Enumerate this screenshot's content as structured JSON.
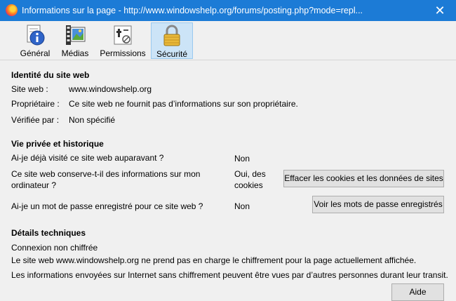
{
  "window": {
    "title": "Informations sur la page - http://www.windowshelp.org/forums/posting.php?mode=repl...",
    "close_glyph": "✕"
  },
  "tabs": [
    {
      "label": "Général",
      "icon": "info-icon",
      "active": false
    },
    {
      "label": "Médias",
      "icon": "media-icon",
      "active": false
    },
    {
      "label": "Permissions",
      "icon": "permissions-icon",
      "active": false
    },
    {
      "label": "Sécurité",
      "icon": "padlock-icon",
      "active": true
    }
  ],
  "identity": {
    "title": "Identité du site web",
    "rows": [
      {
        "label": "Site web :",
        "value": "www.windowshelp.org"
      },
      {
        "label": "Propriétaire :",
        "value": "Ce site web ne fournit pas d’informations sur son propriétaire."
      },
      {
        "label": "Vérifiée par :",
        "value": "Non spécifié"
      }
    ]
  },
  "privacy": {
    "title": "Vie privée et historique",
    "q1": {
      "question": "Ai-je déjà visité ce site web auparavant ?",
      "answer": "Non"
    },
    "q2": {
      "question": "Ce site web conserve-t-il des informations sur mon ordinateur ?",
      "answer": "Oui, des cookies",
      "button": "Effacer les cookies et les données de sites"
    },
    "q3": {
      "question": "Ai-je un mot de passe enregistré pour ce site web ?",
      "answer": "Non",
      "button": "Voir les mots de passe enregistrés"
    }
  },
  "technical": {
    "title": "Détails techniques",
    "line1": "Connexion non chiffrée",
    "line2": "Le site web www.windowshelp.org ne prend pas en charge le chiffrement pour la page actuellement affichée.",
    "line3": "Les informations envoyées sur Internet sans chiffrement peuvent être vues par d’autres personnes durant leur transit."
  },
  "help_button": "Aide"
}
